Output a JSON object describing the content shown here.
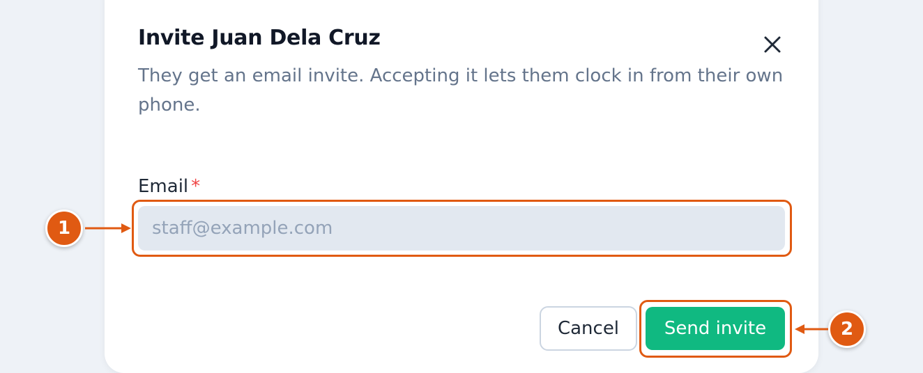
{
  "dialog": {
    "title": "Invite Juan Dela Cruz",
    "description": "They get an email invite. Accepting it lets them clock in from their own phone.",
    "close_icon": "close-icon"
  },
  "form": {
    "email_label": "Email",
    "required_marker": "*",
    "email_placeholder": "staff@example.com",
    "email_value": ""
  },
  "actions": {
    "cancel_label": "Cancel",
    "send_label": "Send invite"
  },
  "annotations": [
    {
      "number": "1",
      "target": "email-input"
    },
    {
      "number": "2",
      "target": "send-invite-button"
    }
  ],
  "colors": {
    "accent_green": "#10b981",
    "annotation_orange": "#e05a12",
    "required_red": "#ef4444",
    "backdrop": "#eef2f7"
  }
}
